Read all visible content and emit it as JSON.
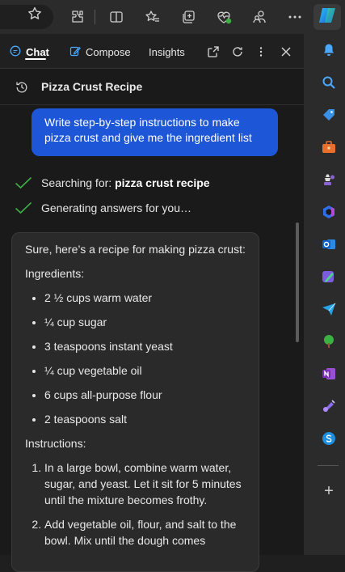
{
  "toolbar": {
    "icons": [
      "favorite-star-icon",
      "extensions-icon",
      "split-screen-icon",
      "favorites-icon",
      "collections-icon",
      "browser-essentials-icon",
      "profile-icon",
      "more-icon",
      "copilot-icon"
    ]
  },
  "tabs": [
    {
      "label": "Chat",
      "active": true
    },
    {
      "label": "Compose",
      "active": false
    },
    {
      "label": "Insights",
      "active": false
    }
  ],
  "conversation": {
    "title": "Pizza Crust Recipe",
    "user_message": "Write step-by-step instructions to make pizza crust and give me the ingredient list",
    "status": {
      "searching_prefix": "Searching for: ",
      "searching_query": "pizza crust recipe",
      "generating": "Generating answers for you…"
    }
  },
  "answer": {
    "intro": "Sure, here’s a recipe for making pizza crust:",
    "ingredients_heading": "Ingredients:",
    "ingredients": [
      "2 ½ cups warm water",
      "¼ cup sugar",
      "3 teaspoons instant yeast",
      "¼ cup vegetable oil",
      "6 cups all-purpose flour",
      "2 teaspoons salt"
    ],
    "instructions_heading": "Instructions:",
    "steps": [
      "In a large bowl, combine warm water, sugar, and yeast. Let it sit for 5 minutes until the mixture becomes frothy.",
      "Add vegetable oil, flour, and salt to the bowl. Mix until the dough comes"
    ]
  },
  "sidebar": {
    "apps": [
      "notifications-icon",
      "search-icon",
      "shopping-icon",
      "tools-icon",
      "games-icon",
      "microsoft-365-icon",
      "outlook-icon",
      "designer-icon",
      "send-icon",
      "tree-icon",
      "onenote-icon",
      "drop-icon",
      "skype-icon"
    ],
    "add_label": "+"
  },
  "colors": {
    "accent": "#1e56d8",
    "check": "#3cb043",
    "pane_bg": "#1a1a1a",
    "card_bg": "#2a2a2a"
  }
}
